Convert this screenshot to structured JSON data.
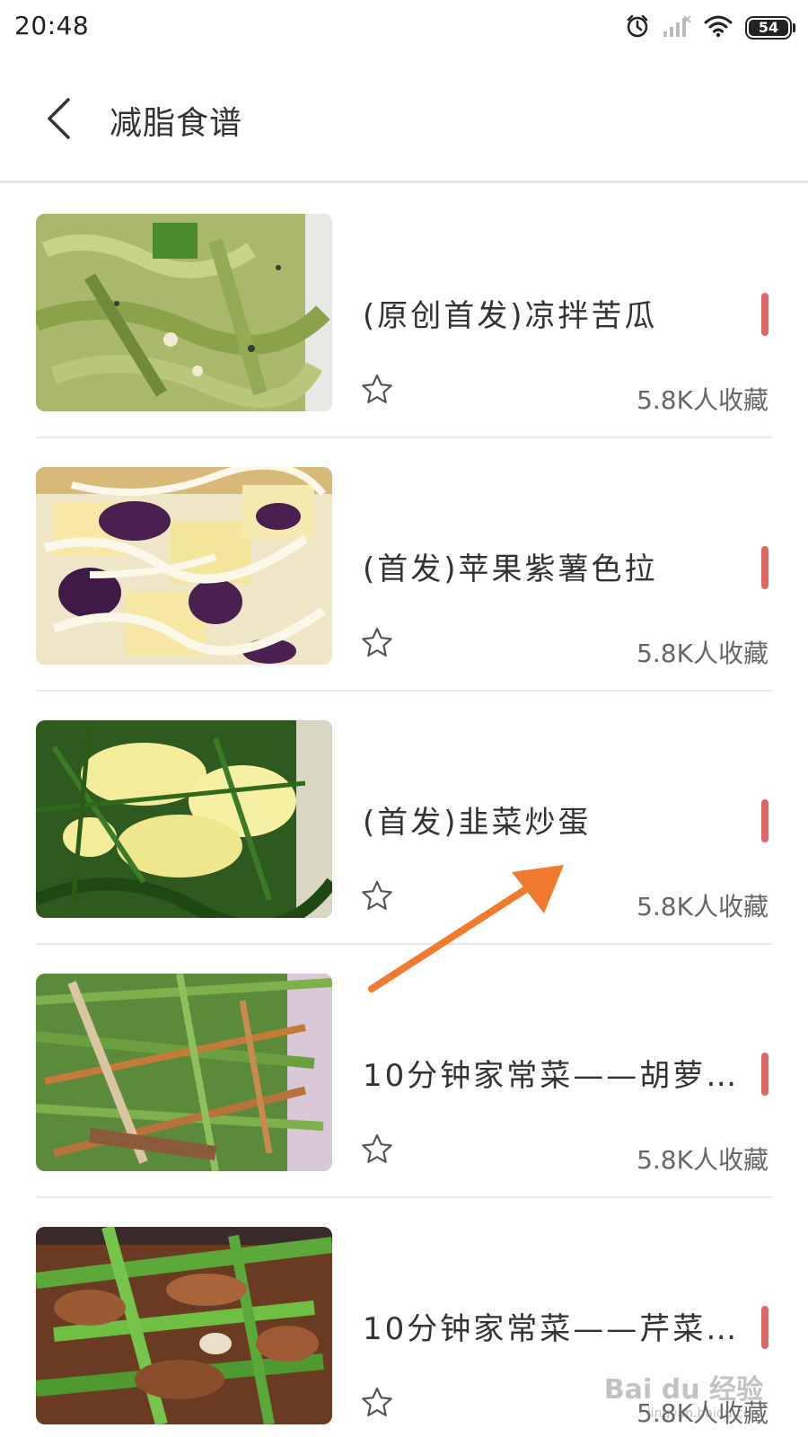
{
  "status_bar": {
    "time": "20:48",
    "battery": "54",
    "icons": [
      "alarm-icon",
      "cellular-signal-icon",
      "wifi-icon",
      "battery-icon"
    ]
  },
  "header": {
    "title": "减脂食谱",
    "back_icon": "chevron-left-icon"
  },
  "recipes": [
    {
      "title": "(原创首发)凉拌苦瓜",
      "favorites": "5.8K人收藏",
      "image": "bitter-melon-salad"
    },
    {
      "title": "(首发)苹果紫薯色拉",
      "favorites": "5.8K人收藏",
      "image": "apple-purple-potato-salad"
    },
    {
      "title": "(首发)韭菜炒蛋",
      "favorites": "5.8K人收藏",
      "image": "chive-scrambled-egg"
    },
    {
      "title": "10分钟家常菜——胡萝…",
      "favorites": "5.8K人收藏",
      "image": "carrot-stir-fry"
    },
    {
      "title": "10分钟家常菜——芹菜…",
      "favorites": "5.8K人收藏",
      "image": "celery-stir-fry"
    }
  ],
  "colors": {
    "accent_bar": "#e06565",
    "annotation_arrow": "#f07a2e",
    "divider": "#e8e8e8"
  },
  "watermark": {
    "main": "Bai du 经验",
    "sub": "jingyan.baidu.com"
  }
}
